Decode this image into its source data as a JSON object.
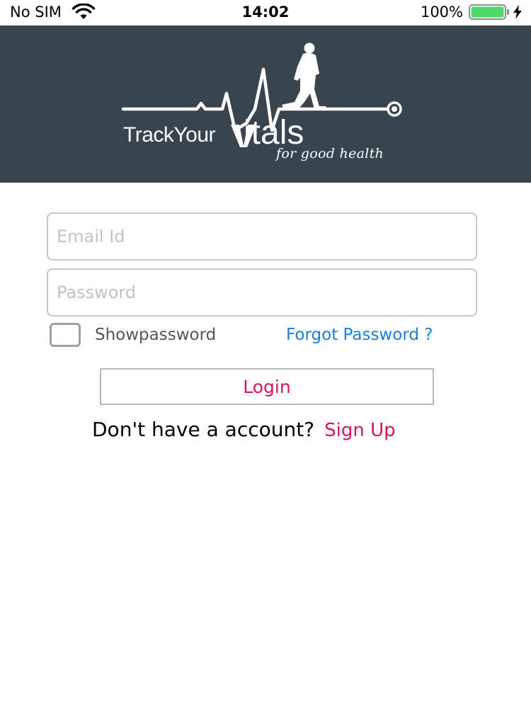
{
  "status_bar": {
    "carrier": "No SIM",
    "time": "14:02",
    "battery_percent": "100%",
    "battery_level": 1.0,
    "icons": [
      "wifi-icon",
      "battery-icon",
      "charging-icon"
    ]
  },
  "header": {
    "background_color": "#38454e",
    "logo": {
      "name_prefix": "TrackYour",
      "name_suffix": "itals",
      "tagline": "for good health"
    }
  },
  "login_form": {
    "email_placeholder": "Email Id",
    "email_value": "",
    "password_placeholder": "Password",
    "password_value": "",
    "show_password_label": "Showpassword",
    "show_password_checked": false,
    "forgot_password_label": "Forgot Password ?",
    "login_label": "Login",
    "signup_prompt": "Don't have a account?",
    "signup_label": "Sign Up"
  },
  "colors": {
    "accent_pink": "#d8145a",
    "link_blue": "#1a7fd6",
    "battery_green": "#4cd964"
  }
}
